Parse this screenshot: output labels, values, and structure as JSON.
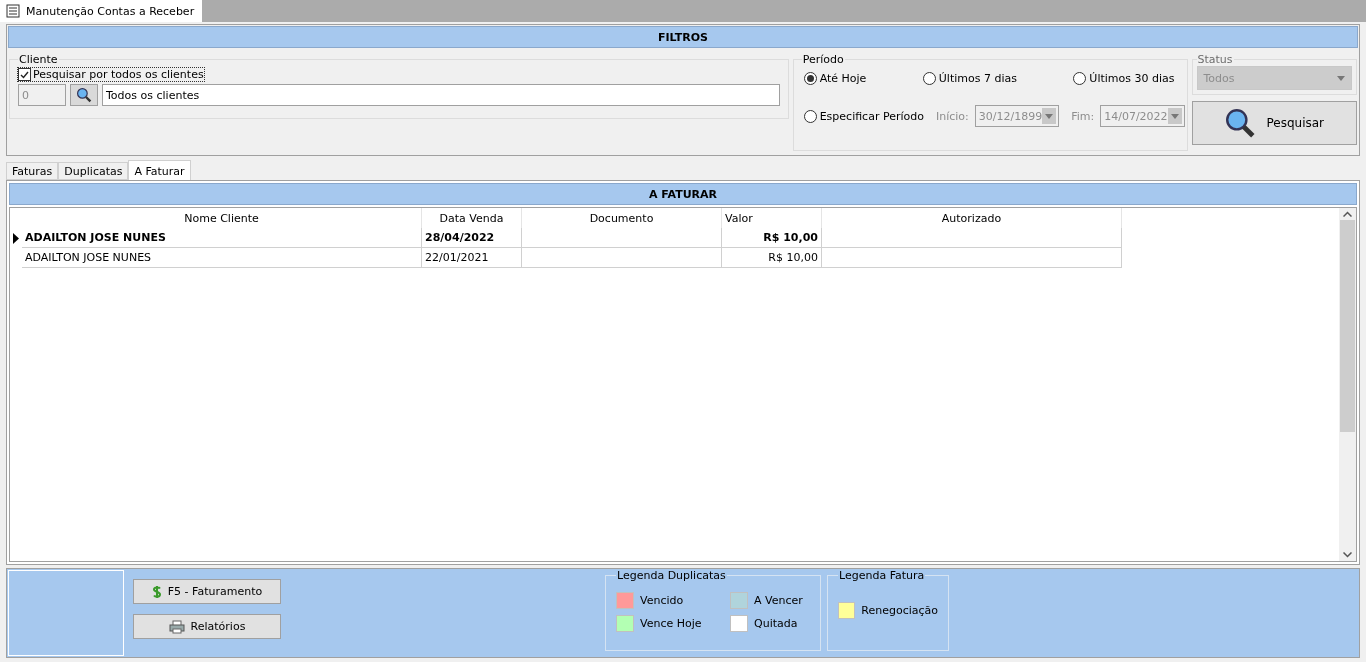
{
  "window": {
    "title": "Manutenção Contas a Receber"
  },
  "filters": {
    "title": "FILTROS",
    "client": {
      "legend": "Cliente",
      "checkbox": {
        "label": "Pesquisar por todos os clientes",
        "checked": true
      },
      "code": "0",
      "name": "Todos os clientes"
    },
    "period": {
      "legend": "Período",
      "options": [
        {
          "label": "Até Hoje",
          "selected": true
        },
        {
          "label": "Últimos 7 dias",
          "selected": false
        },
        {
          "label": "Últimos 30 dias",
          "selected": false
        },
        {
          "label": "Especificar Período",
          "selected": false
        }
      ],
      "start_label": "Início:",
      "start": "30/12/1899",
      "end_label": "Fim:",
      "end": "14/07/2022",
      "dates_disabled": true
    },
    "status": {
      "legend": "Status",
      "value": "Todos",
      "disabled": true
    },
    "search_button": "Pesquisar"
  },
  "tabs": [
    {
      "label": "Faturas",
      "selected": false
    },
    {
      "label": "Duplicatas",
      "selected": false
    },
    {
      "label": "A Faturar",
      "selected": true
    }
  ],
  "grid": {
    "title": "A FATURAR",
    "columns": [
      "Nome Cliente",
      "Data Venda",
      "Documento",
      "Valor",
      "Autorizado"
    ],
    "rows": [
      {
        "selected": true,
        "cells": [
          "ADAILTON JOSE NUNES",
          "28/04/2022",
          "",
          "R$ 10,00",
          ""
        ]
      },
      {
        "selected": false,
        "cells": [
          "ADAILTON JOSE NUNES",
          "22/01/2021",
          "",
          "R$ 10,00",
          ""
        ]
      }
    ]
  },
  "footer": {
    "buttons": [
      {
        "kind": "billing",
        "label": "F5 - Faturamento"
      },
      {
        "kind": "print",
        "label": "Relatórios"
      }
    ],
    "legend_duplicatas": {
      "title": "Legenda Duplicatas",
      "items": [
        {
          "label": "Vencido",
          "color": "#ff9999"
        },
        {
          "label": "A Vencer",
          "color": "#b0d4dc"
        },
        {
          "label": "Vence Hoje",
          "color": "#b3ffb3"
        },
        {
          "label": "Quitada",
          "color": "#ffffff"
        }
      ]
    },
    "legend_fatura": {
      "title": "Legenda Fatura",
      "items": [
        {
          "label": "Renegociação",
          "color": "#ffff99"
        }
      ]
    }
  }
}
